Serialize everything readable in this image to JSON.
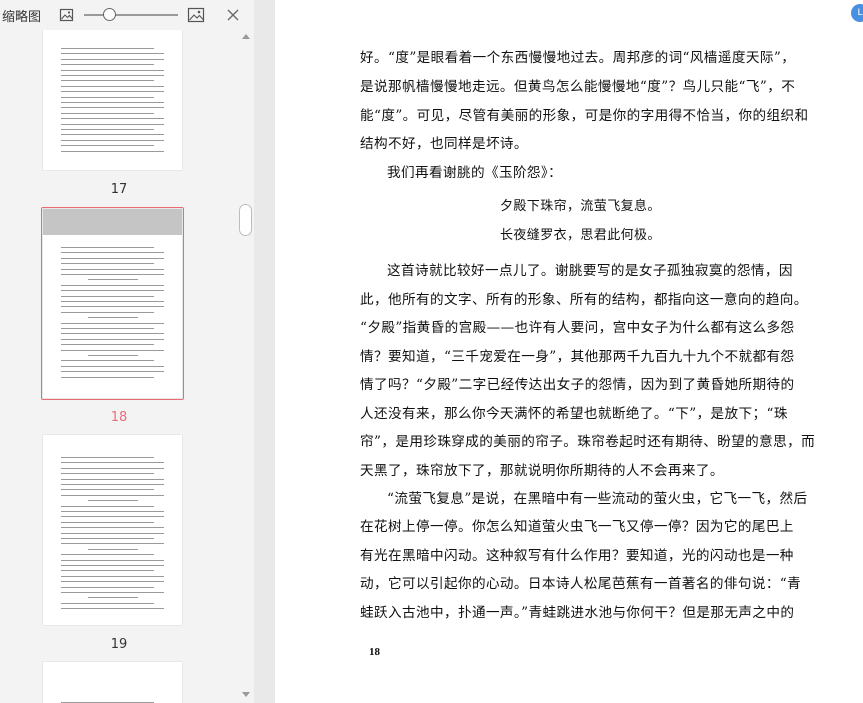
{
  "sidebar": {
    "title": "缩略图",
    "zoom_level": 0.27,
    "thumbnails": [
      {
        "label": "17",
        "active": false
      },
      {
        "label": "18",
        "active": true
      },
      {
        "label": "19",
        "active": false
      }
    ]
  },
  "colors": {
    "accent": "#ea6a72",
    "badge": "#4a90e2"
  },
  "icons": [
    "thumbnail-small-icon",
    "thumbnail-large-icon",
    "close-icon",
    "scroll-up-icon",
    "scroll-down-icon"
  ],
  "corner_badge": "L",
  "page": {
    "number": "18",
    "lines": [
      "好。“度”是眼看着一个东西慢慢地过去。周邦彦的词“风樯遥度天际”，",
      "是说那帆樯慢慢地走远。但黄鸟怎么能慢慢地“度”？鸟儿只能“飞”，不",
      "能“度”。可见，尽管有美丽的形象，可是你的字用得不恰当，你的组织和",
      "结构不好，也同样是坏诗。",
      "我们再看谢朓的《玉阶怨》：",
      "夕殿下珠帘，流萤飞复息。",
      "长夜缝罗衣，思君此何极。",
      "这首诗就比较好一点儿了。谢朓要写的是女子孤独寂寞的怨情，因",
      "此，他所有的文字、所有的形象、所有的结构，都指向这一意向的趋向。",
      "“夕殿”指黄昏的宫殿——也许有人要问，宫中女子为什么都有这么多怨",
      "情？要知道，“三千宠爱在一身”，其他那两千九百九十九个不就都有怨",
      "情了吗？“夕殿”二字已经传达出女子的怨情，因为到了黄昏她所期待的",
      "人还没有来，那么你今天满怀的希望也就断绝了。“下”，是放下；“珠",
      "帘”，是用珍珠穿成的美丽的帘子。珠帘卷起时还有期待、盼望的意思，而",
      "天黑了，珠帘放下了，那就说明你所期待的人不会再来了。",
      "“流萤飞复息”是说，在黑暗中有一些流动的萤火虫，它飞一飞，然后",
      "在花树上停一停。你怎么知道萤火虫飞一飞又停一停？因为它的尾巴上",
      "有光在黑暗中闪动。这种叙写有什么作用？要知道，光的闪动也是一种",
      "动，它可以引起你的心动。日本诗人松尾芭蕉有一首著名的俳句说：“青",
      "蛙跃入古池中，扑通一声。”青蛙跳进水池与你何干？但是那无声之中的"
    ]
  }
}
